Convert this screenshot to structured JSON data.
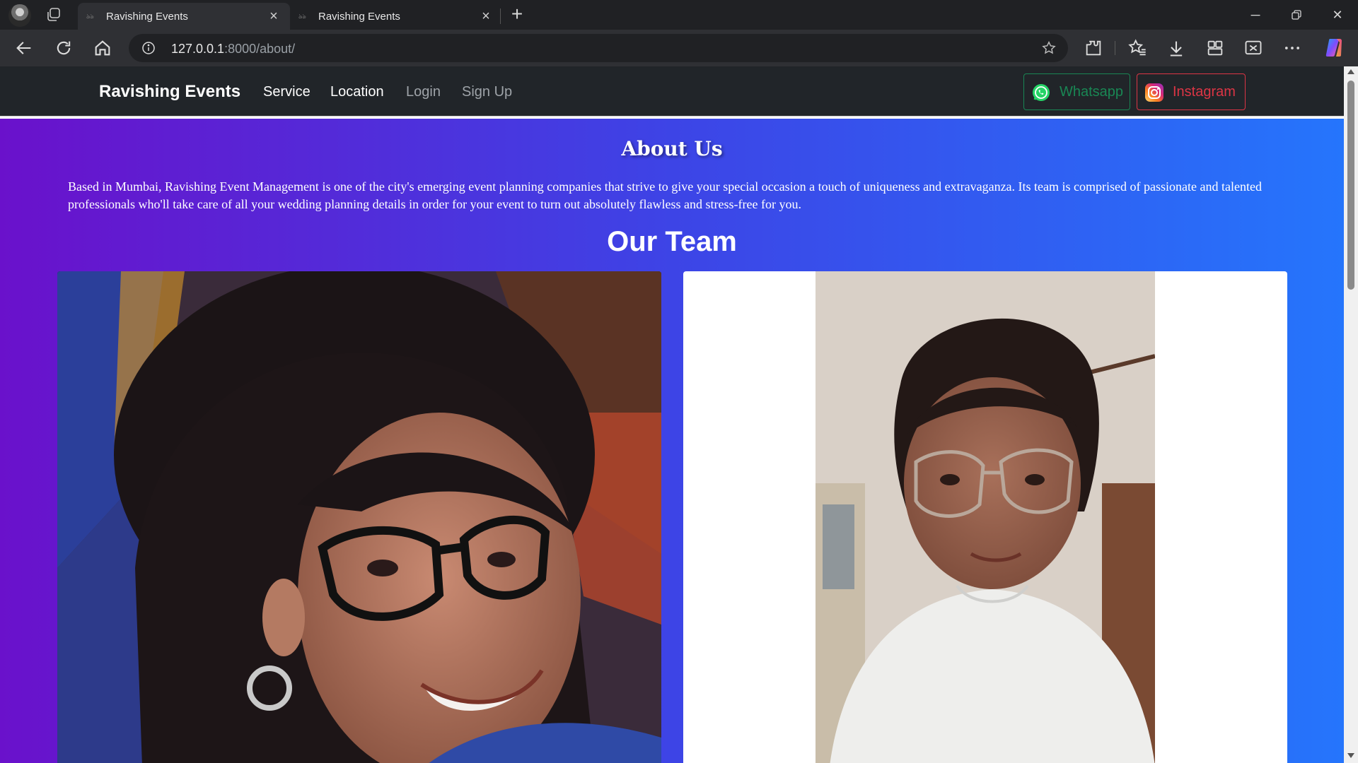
{
  "browser": {
    "tabs": [
      {
        "title": "Ravishing Events",
        "active": true
      },
      {
        "title": "Ravishing Events",
        "active": false
      }
    ],
    "url": {
      "host": "127.0.0.1",
      "path": ":8000/about/"
    },
    "icons": [
      "profile-avatar",
      "tab-actions-icon",
      "back-icon",
      "refresh-icon",
      "home-icon",
      "site-info-icon",
      "favorite-star-icon",
      "extensions-icon",
      "favorites-icon",
      "downloads-icon",
      "collections-icon",
      "screenshot-icon",
      "more-icon",
      "copilot-icon"
    ]
  },
  "navbar": {
    "brand": "Ravishing Events",
    "links": [
      {
        "label": "Service",
        "active": true
      },
      {
        "label": "Location",
        "active": true
      },
      {
        "label": "Login",
        "active": false
      },
      {
        "label": "Sign Up",
        "active": false
      }
    ],
    "whatsapp": "Whatsapp",
    "instagram": "Instagram"
  },
  "about": {
    "title": "About Us",
    "text": "Based in Mumbai, Ravishing Event Management is one of the city's emerging event planning companies that strive to give your special occasion a touch of uniqueness and extravaganza. Its team is comprised of passionate and talented professionals who'll take care of all your wedding planning details in order for your event to turn out absolutely flawless and stress-free for you."
  },
  "team": {
    "title": "Our Team",
    "members": [
      {
        "photo": "team-member-photo-1"
      },
      {
        "photo": "team-member-photo-2"
      }
    ]
  },
  "colors": {
    "gradient_start": "#6a11cb",
    "gradient_end": "#2575fc",
    "navbar_bg": "#212529",
    "whatsapp": "#198754",
    "instagram": "#dc3545"
  }
}
